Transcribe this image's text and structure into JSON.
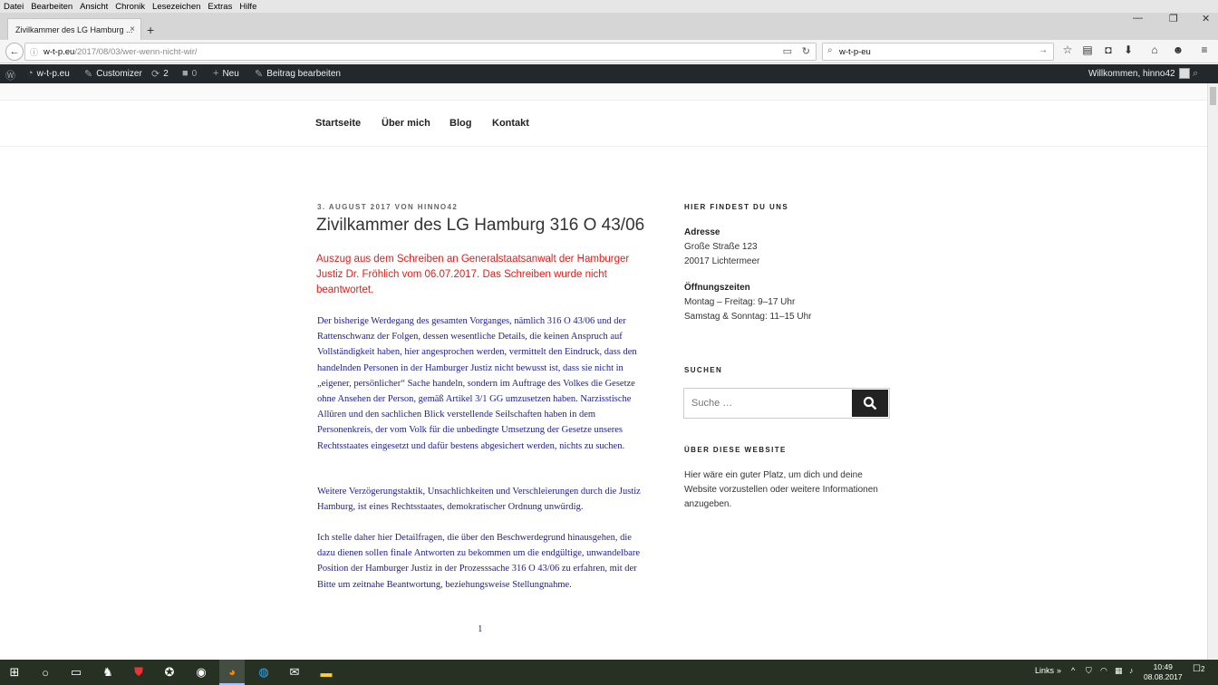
{
  "browser": {
    "menu": [
      "Datei",
      "Bearbeiten",
      "Ansicht",
      "Chronik",
      "Lesezeichen",
      "Extras",
      "Hilfe"
    ],
    "tab_title": "Zivilkammer des LG Hamburg ...",
    "tab_close": "×",
    "new_tab": "+",
    "url_domain": "w-t-p.eu",
    "url_path": "/2017/08/03/wer-wenn-nicht-wir/",
    "search_text": "w-t-p-eu"
  },
  "adminbar": {
    "site": "w-t-p.eu",
    "customizer": "Customizer",
    "updates": "2",
    "comments": "0",
    "new": "Neu",
    "edit": "Beitrag bearbeiten",
    "welcome": "Willkommen, hinno42"
  },
  "site_nav": [
    "Startseite",
    "Über mich",
    "Blog",
    "Kontakt"
  ],
  "post": {
    "meta": "3. August 2017 von hinno42",
    "title": "Zivilkammer des LG Hamburg 316 O 43/06",
    "excerpt": "Auszug aus dem Schreiben an Generalstaatsanwalt der Hamburger Justiz Dr. Fröhlich vom 06.07.2017. Das Schreiben wurde nicht beantwortet.",
    "paragraphs": [
      "Der bisherige Werdegang des gesamten Vorganges, nämlich 316 O 43/06 und der Rattenschwanz der Folgen, dessen wesentliche Details, die keinen Anspruch auf Vollständigkeit haben, hier angesprochen werden, vermittelt den Eindruck, dass den handelnden Personen in der Hamburger Justiz nicht bewusst ist, dass sie nicht in „eigener, persönlicher“ Sache handeln, sondern im Auftrage des Volkes die Gesetze ohne Ansehen der Person, gemäß Artikel 3/1 GG umzusetzen haben. Narzisstische Allüren und den sachlichen Blick verstellende Seilschaften haben in dem Personenkreis, der vom Volk für die unbedingte Umsetzung der Gesetze unseres Rechtsstaates eingesetzt und dafür bestens abgesichert werden, nichts zu suchen.",
      "Weitere Verzögerungstaktik, Unsachlichkeiten und Verschleierungen durch die Justiz Hamburg, ist eines Rechtsstaates, demokratischer Ordnung unwürdig.",
      "Ich stelle daher hier Detailfragen, die über den Beschwerdegrund hinausgehen, die dazu dienen sollen finale Antworten zu bekommen um die endgültige, unwandelbare Position der Hamburger Justiz in der Prozesssache 316 O 43/06 zu erfahren, mit der Bitte um zeitnahe Beantwortung, beziehungsweise Stellungnahme."
    ],
    "section_number": "1"
  },
  "sidebar": {
    "find_title": "Hier findest du uns",
    "address_label": "Adresse",
    "address_line1": "Große Straße 123",
    "address_line2": "20017 Lichtermeer",
    "hours_label": "Öffnungszeiten",
    "hours_line1": "Montag – Freitag: 9–17 Uhr",
    "hours_line2": "Samstag & Sonntag: 11–15 Uhr",
    "search_title": "Suchen",
    "search_placeholder": "Suche …",
    "about_title": "Über diese Website",
    "about_text": "Hier wäre ein guter Platz, um dich und deine Website vorzustellen oder weitere Informationen anzugeben."
  },
  "taskbar": {
    "links_label": "Links",
    "time": "10:49",
    "date": "08.08.2017",
    "notifications": "2"
  },
  "colors": {
    "excerpt": "#e0201b",
    "body_text": "#1e1e8c",
    "adminbar": "#23282d"
  }
}
